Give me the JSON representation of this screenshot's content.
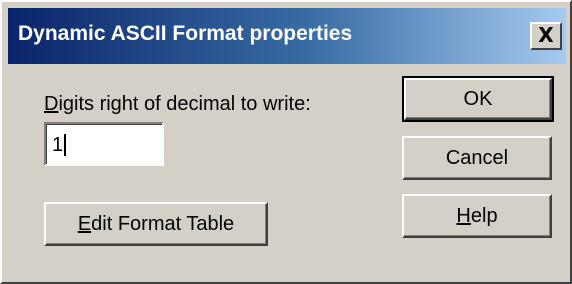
{
  "window": {
    "title": "Dynamic ASCII Format properties",
    "close_label": "X"
  },
  "digits": {
    "label_access_key": "D",
    "label_rest": "igits right of decimal to write:",
    "value": "1"
  },
  "buttons": {
    "edit_access_key": "E",
    "edit_rest": "dit Format Table",
    "ok": "OK",
    "cancel": "Cancel",
    "help_access_key": "H",
    "help_rest": "elp"
  },
  "colors": {
    "dialog_face": "#d4d0c8",
    "title_gradient_start": "#0a246a",
    "title_gradient_end": "#a6caf0"
  }
}
